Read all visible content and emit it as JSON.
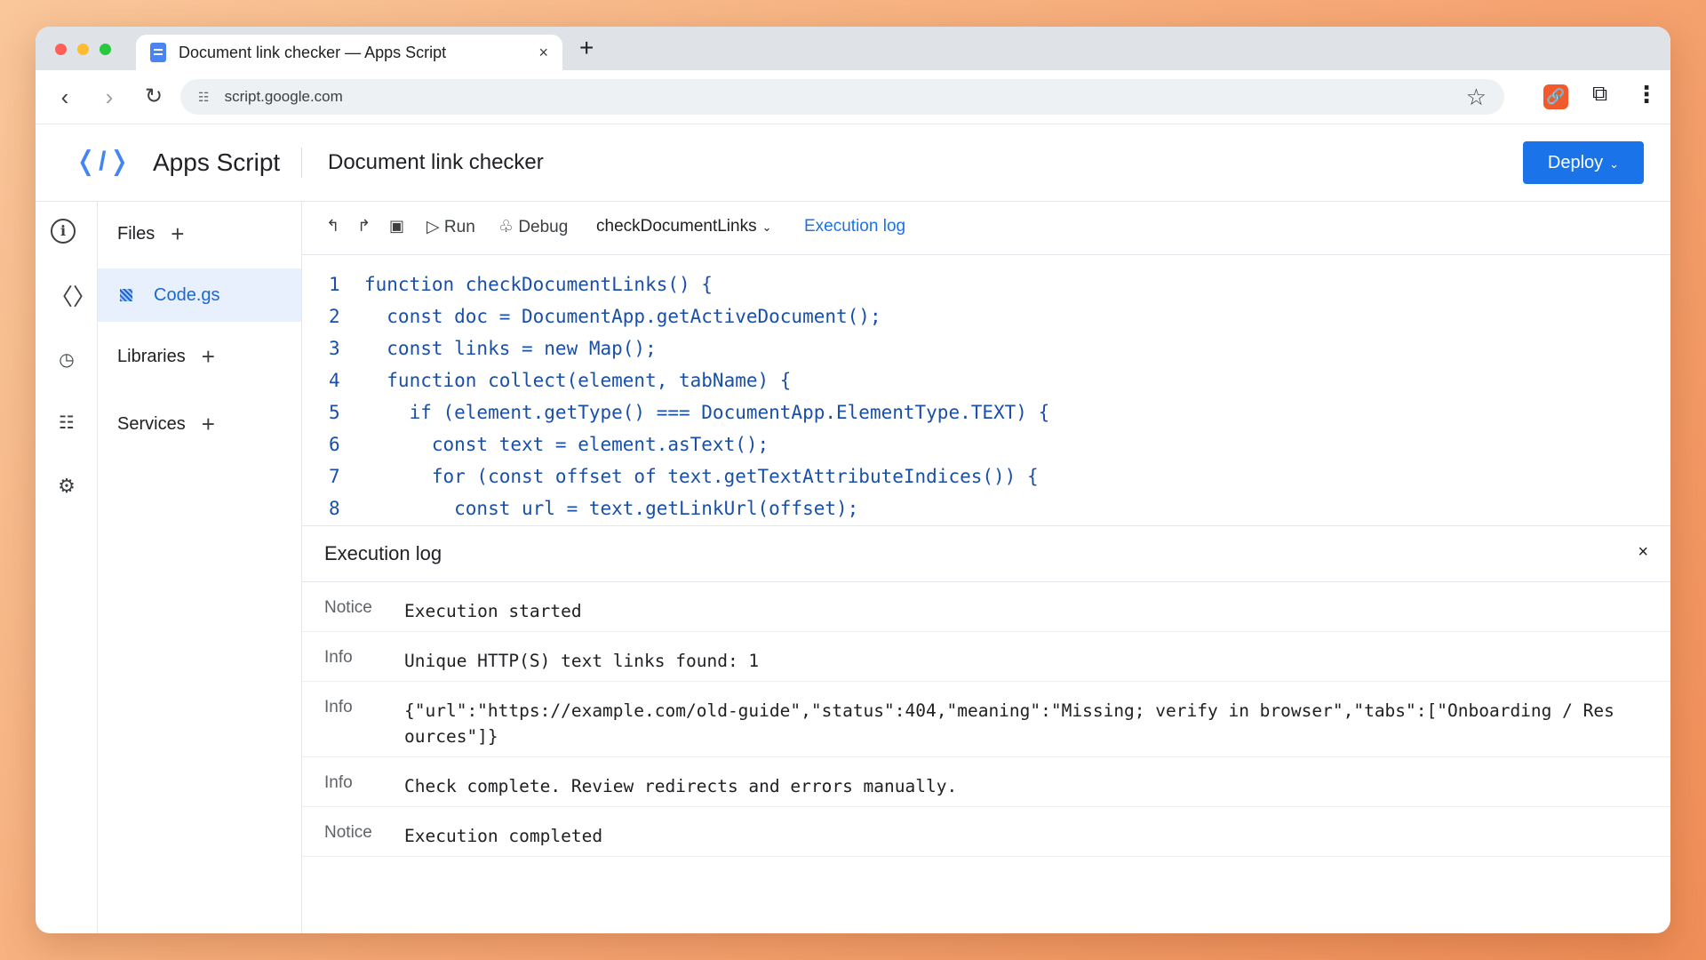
{
  "browser": {
    "tab_title": "Document link checker — Apps Script",
    "tab_close": "×",
    "new_tab": "+",
    "url": "script.google.com"
  },
  "header": {
    "app_name": "Apps Script",
    "project_name": "Document link checker",
    "deploy_label": "Deploy"
  },
  "files_panel": {
    "files_label": "Files",
    "active_file": "Code.gs",
    "libraries_label": "Libraries",
    "services_label": "Services"
  },
  "editor_toolbar": {
    "run_label": "Run",
    "debug_label": "Debug",
    "function_name": "checkDocumentLinks",
    "execution_log_label": "Execution log"
  },
  "code": [
    {
      "n": "1",
      "text": "function checkDocumentLinks() {"
    },
    {
      "n": "2",
      "text": "  const doc = DocumentApp.getActiveDocument();"
    },
    {
      "n": "3",
      "text": "  const links = new Map();"
    },
    {
      "n": "4",
      "text": "  function collect(element, tabName) {"
    },
    {
      "n": "5",
      "text": "    if (element.getType() === DocumentApp.ElementType.TEXT) {"
    },
    {
      "n": "6",
      "text": "      const text = element.asText();"
    },
    {
      "n": "7",
      "text": "      for (const offset of text.getTextAttributeIndices()) {"
    },
    {
      "n": "8",
      "text": "        const url = text.getLinkUrl(offset);"
    }
  ],
  "execution_log": {
    "title": "Execution log",
    "close": "×",
    "entries": [
      {
        "level": "Notice",
        "message": "Execution started"
      },
      {
        "level": "Info",
        "message": "Unique HTTP(S) text links found: 1"
      },
      {
        "level": "Info",
        "message": "{\"url\":\"https://example.com/old-guide\",\"status\":404,\"meaning\":\"Missing; verify in browser\",\"tabs\":[\"Onboarding / Resources\"]}"
      },
      {
        "level": "Info",
        "message": "Check complete. Review redirects and errors manually."
      },
      {
        "level": "Notice",
        "message": "Execution completed"
      }
    ]
  },
  "colors": {
    "accent": "#1a73e8",
    "code_text": "#1a4fa8",
    "active_file_bg": "#e8f0fe"
  }
}
